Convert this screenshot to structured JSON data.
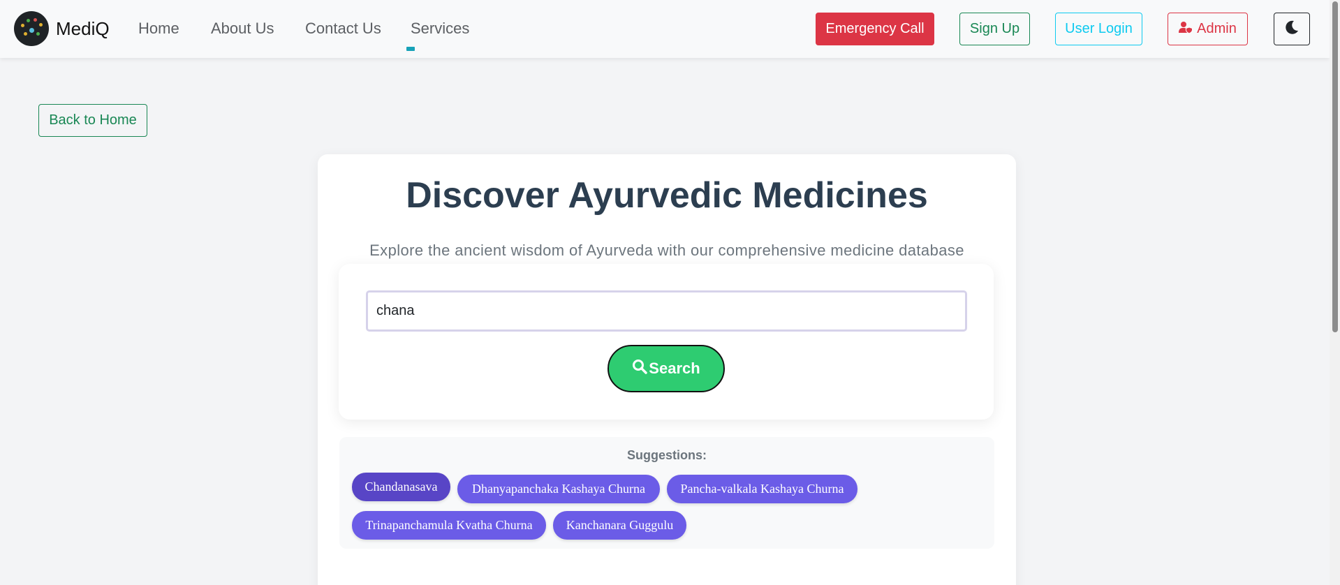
{
  "navbar": {
    "brand": "MediQ",
    "links": [
      "Home",
      "About Us",
      "Contact Us",
      "Services"
    ],
    "emergency_label": "Emergency Call",
    "signup_label": "Sign Up",
    "user_login_label": "User Login",
    "admin_label": "Admin",
    "theme_icon": "moon-icon"
  },
  "back_label": "Back to Home",
  "hero": {
    "title": "Discover Ayurvedic Medicines",
    "subtitle": "Explore the ancient wisdom of Ayurveda with our comprehensive medicine database"
  },
  "search": {
    "value": "chana",
    "button_label": "Search"
  },
  "suggestions": {
    "label": "Suggestions:",
    "items": [
      "Chandanasava",
      "Dhanyapanchaka Kashaya Churna",
      "Pancha-valkala Kashaya Churna",
      "Trinapanchamula Kvatha Churna",
      "Kanchanara Guggulu"
    ]
  },
  "colors": {
    "emergency": "#dc3545",
    "signup": "#198754",
    "user_login": "#0dcaf0",
    "search_button": "#2ecc71",
    "chip": "#6b5ce7"
  }
}
